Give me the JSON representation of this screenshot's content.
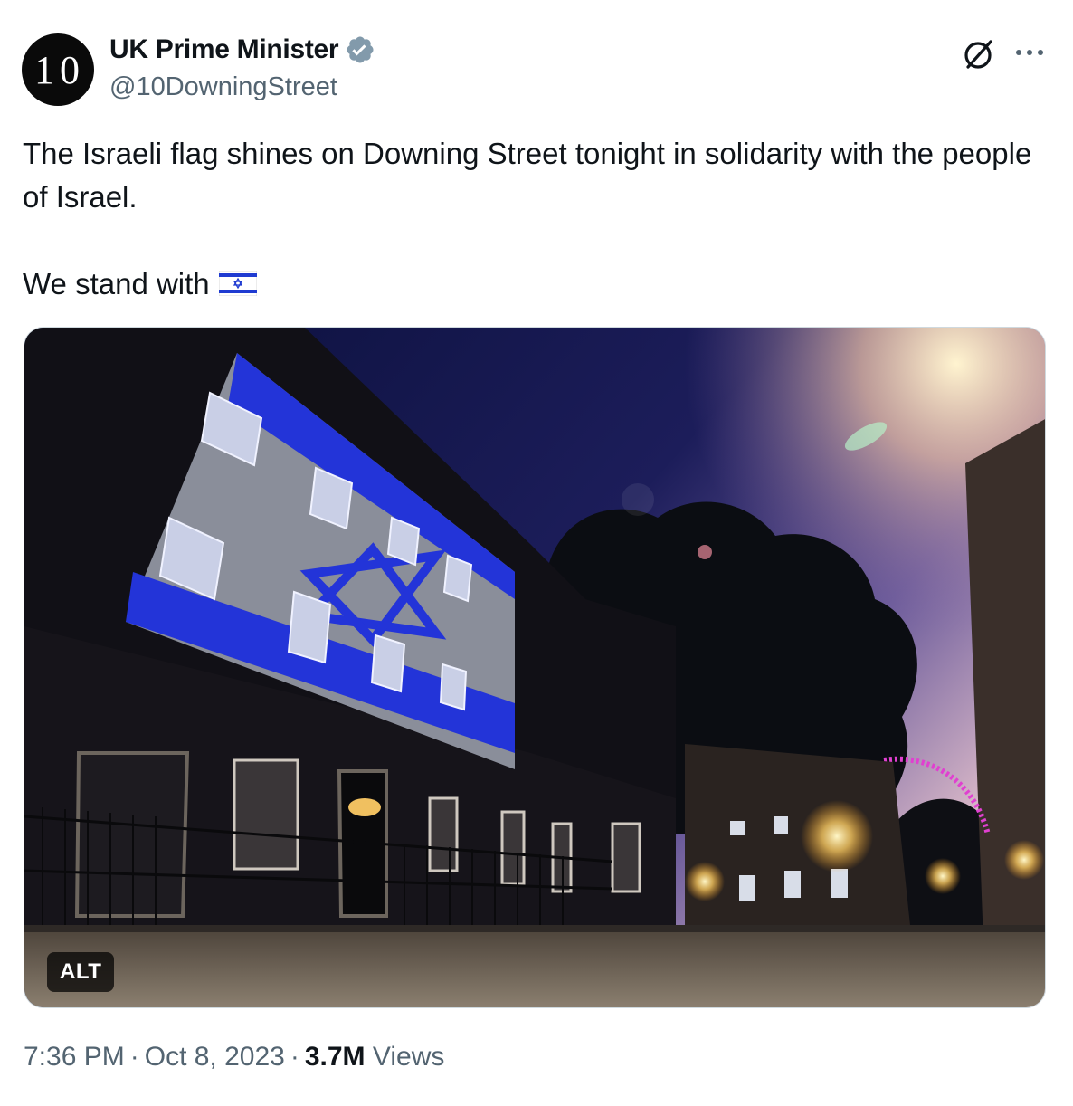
{
  "author": {
    "avatar_text": "10",
    "display_name": "UK Prime Minister",
    "handle": "@10DowningStreet",
    "verified_icon": "verified-badge-icon"
  },
  "actions": {
    "grok_icon": "grok-icon",
    "more_icon": "more-options-icon"
  },
  "tweet": {
    "line1": "The Israeli flag shines on Downing Street tonight in solidarity with the people of Israel.",
    "line2": "We stand with",
    "emoji": "israel-flag-emoji"
  },
  "media": {
    "alt_label": "ALT"
  },
  "meta": {
    "time": "7:36 PM",
    "date": "Oct 8, 2023",
    "views_count": "3.7M",
    "views_label": "Views"
  },
  "colors": {
    "text": "#0f1419",
    "secondary": "#536471",
    "verified": "#829aab",
    "flag_blue": "#1f3bd1"
  }
}
